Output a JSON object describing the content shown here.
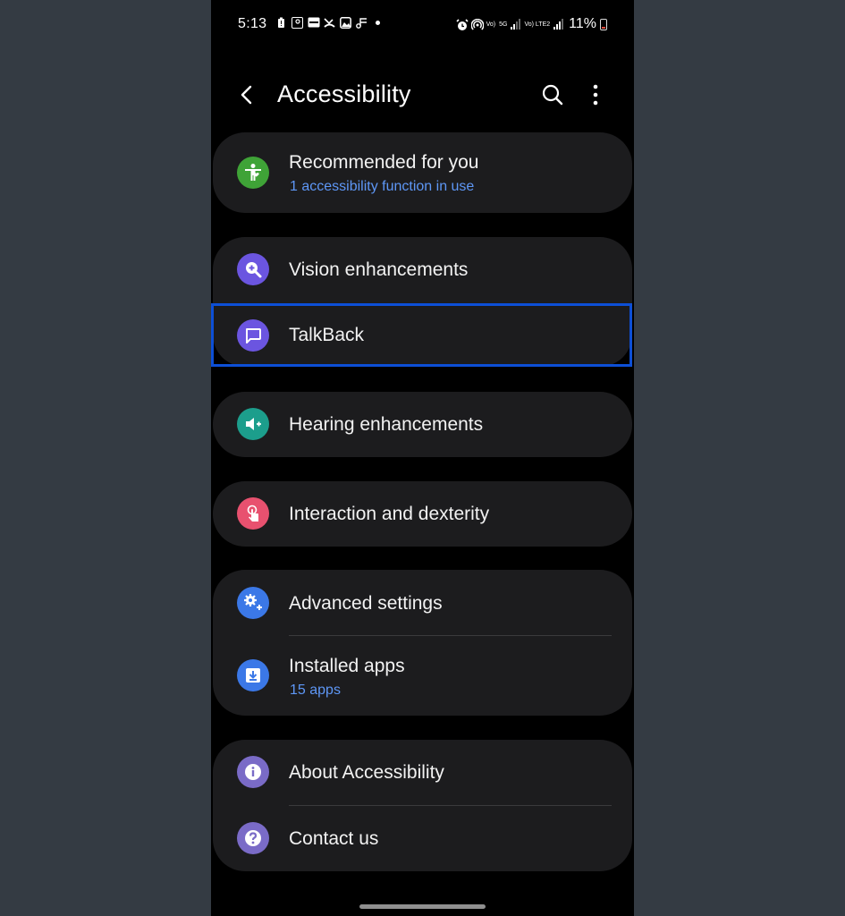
{
  "status_bar": {
    "time": "5:13",
    "battery_percent": "11%",
    "net_labels": {
      "volte1": "Vo)",
      "g5": "5G",
      "lte2": "Vo) LTE2"
    }
  },
  "header": {
    "title": "Accessibility"
  },
  "sections": {
    "recommended": {
      "title": "Recommended for you",
      "subtitle": "1 accessibility function in use",
      "icon": "accessibility-person-icon",
      "icon_color": "#3fa337"
    },
    "vision": {
      "title": "Vision enhancements",
      "icon": "magnifier-icon",
      "icon_color": "#6b55e0"
    },
    "talkback": {
      "title": "TalkBack",
      "icon": "chat-bubble-icon",
      "icon_color": "#6b55e0"
    },
    "hearing": {
      "title": "Hearing enhancements",
      "icon": "speaker-icon",
      "icon_color": "#1c9e8c"
    },
    "interaction": {
      "title": "Interaction and dexterity",
      "icon": "hand-touch-icon",
      "icon_color": "#e8516f"
    },
    "advanced": {
      "title": "Advanced settings",
      "icon": "gears-icon",
      "icon_color": "#3b78e7"
    },
    "installed": {
      "title": "Installed apps",
      "subtitle": "15 apps",
      "icon": "download-icon",
      "icon_color": "#3b78e7"
    },
    "about": {
      "title": "About Accessibility",
      "icon": "info-icon",
      "icon_color": "#7a6bc7"
    },
    "contact": {
      "title": "Contact us",
      "icon": "question-icon",
      "icon_color": "#7a6bc7"
    }
  },
  "colors": {
    "background": "#343b43",
    "screen": "#000000",
    "card": "#1c1c1e",
    "accent_subtitle": "#5e97f6",
    "focus_border": "#0d4fd6"
  }
}
